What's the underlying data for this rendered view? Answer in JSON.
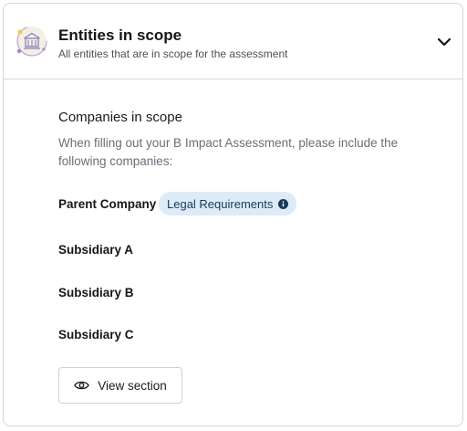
{
  "header": {
    "title": "Entities in scope",
    "subtitle": "All entities that are in scope for the assessment",
    "icon": "building-scope-icon",
    "toggle_icon": "chevron-down-icon"
  },
  "section": {
    "title": "Companies in scope",
    "description": "When filling out your B Impact Assessment, please include the following companies:"
  },
  "companies": [
    {
      "name": "Parent Company",
      "badge": "Legal Requirements",
      "badge_icon": "info-icon"
    },
    {
      "name": "Subsidiary A"
    },
    {
      "name": "Subsidiary B"
    },
    {
      "name": "Subsidiary C"
    }
  ],
  "view_button": {
    "label": "View section",
    "icon": "eye-icon"
  },
  "colors": {
    "badge_bg": "#dcebf7",
    "badge_text": "#173a5c",
    "icon_bg": "#f3efe4",
    "icon_accent": "#9b8ec9",
    "border": "#d6d6da"
  }
}
